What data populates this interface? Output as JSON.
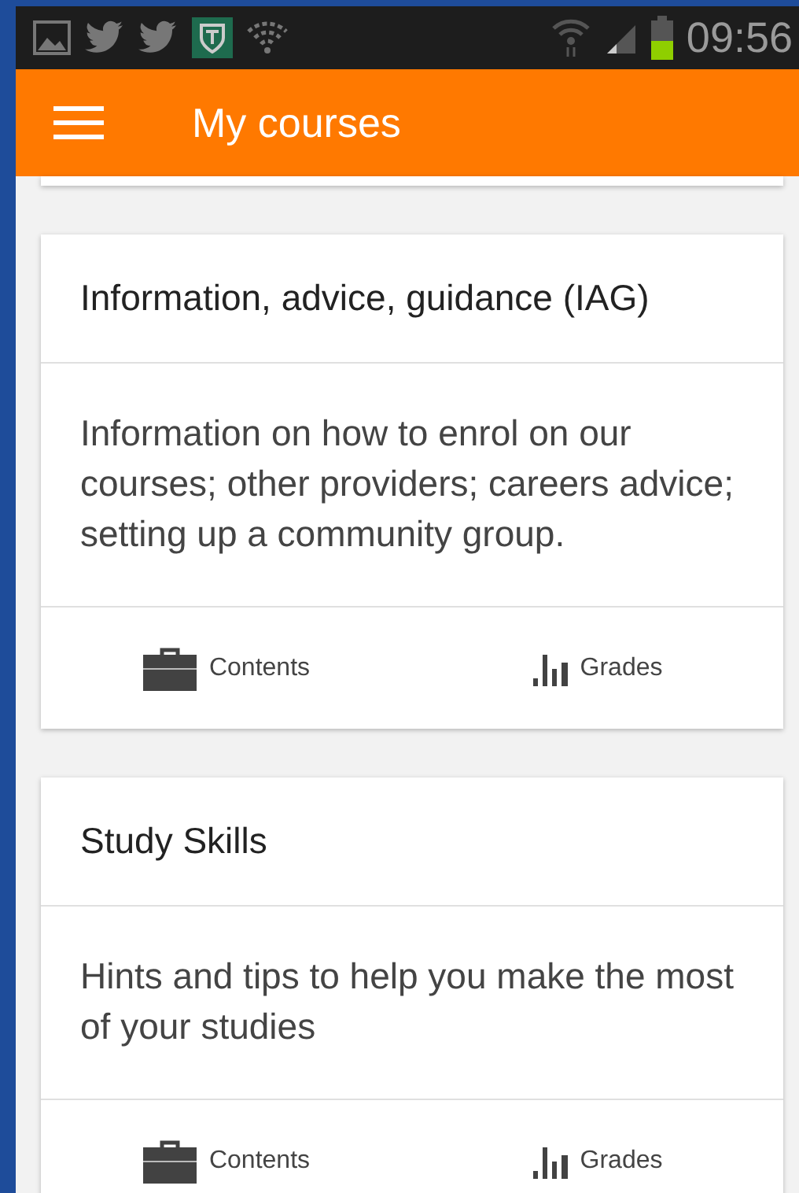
{
  "status_bar": {
    "time": "09:56"
  },
  "app_bar": {
    "title": "My courses"
  },
  "courses": [
    {
      "title": "Information, advice, guidance (IAG)",
      "summary": "Information on how to enrol on our courses; other providers; careers advice; setting up a community group.",
      "actions": [
        {
          "kind": "contents",
          "label": "Contents"
        },
        {
          "kind": "grades",
          "label": "Grades"
        }
      ]
    },
    {
      "title": "Study Skills",
      "summary": "Hints and tips to help you make the most of your studies",
      "actions": [
        {
          "kind": "contents",
          "label": "Contents"
        },
        {
          "kind": "grades",
          "label": "Grades"
        }
      ]
    }
  ]
}
